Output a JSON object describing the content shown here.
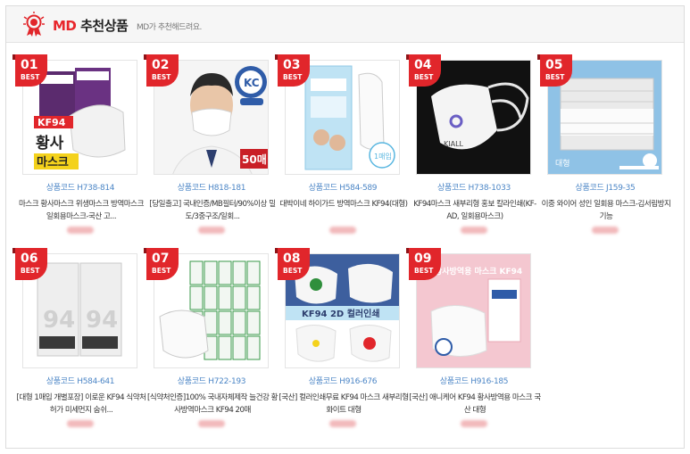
{
  "header": {
    "title_md": "MD",
    "title_rest": "추천상품",
    "subtitle": "MD가 추천해드려요."
  },
  "colors": {
    "accent": "#e1262b",
    "code": "#4c86c6"
  },
  "products": [
    {
      "rank": "01",
      "best": "BEST",
      "code": "상품코드 H738-814",
      "name": "마스크 황사마스크 위생마스크 방역마스크 일회용마스크-국산 고...",
      "image": "kf94-hwangsa-mask-pack"
    },
    {
      "rank": "02",
      "best": "BEST",
      "code": "상품코드 H818-181",
      "name": "[당일출고] 국내인증/MB필터/90%이상 밀도/3중구조/일회...",
      "image": "man-wearing-mask-kc-50"
    },
    {
      "rank": "03",
      "best": "BEST",
      "code": "상품코드 H584-589",
      "name": "대박이네 하이가드 방역마스크 KF94(대형)",
      "image": "higard-mask-pack"
    },
    {
      "rank": "04",
      "best": "BEST",
      "code": "상품코드 H738-1033",
      "name": "KF94마스크 새부리형 홍보 칼라인쇄(KF-AD, 일회용마스크)",
      "image": "white-beak-mask-dark-bg"
    },
    {
      "rank": "05",
      "best": "BEST",
      "code": "상품코드 J159-35",
      "name": "이중 와이어 성인 일회용 마스크-김서림방지기능",
      "image": "pleated-mask-blue-bg"
    },
    {
      "rank": "06",
      "best": "BEST",
      "code": "상품코드 H584-641",
      "name": "[대형 1매입 개별포장] 이로운 KF94 식약처허가 미세먼지 숨쉬...",
      "image": "iroun-kf94-packs"
    },
    {
      "rank": "07",
      "best": "BEST",
      "code": "상품코드 H722-193",
      "name": "[식약처인증]100% 국내자체제작 늘건강 황사방역마스크 KF94 20매",
      "image": "kf94-20-packs"
    },
    {
      "rank": "08",
      "best": "BEST",
      "code": "상품코드 H916-676",
      "name": "[국산] 컬러인쇄무료 KF94 마스크 새부리형 화이트 대형",
      "image": "kf94-2d-print-masks"
    },
    {
      "rank": "09",
      "best": "BEST",
      "code": "상품코드 H916-185",
      "name": "[국산] 애니케어 KF94 황사방역용 마스크 국산 대형",
      "image": "anycare-kf94-pink"
    }
  ]
}
